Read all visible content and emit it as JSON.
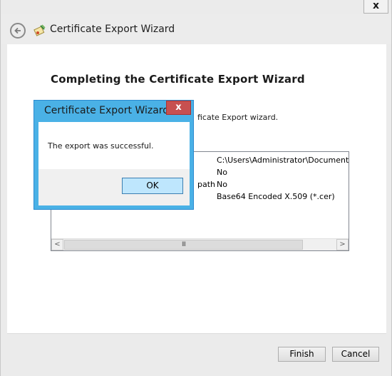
{
  "window": {
    "close_label": "x",
    "title": "Certificate Export Wizard"
  },
  "page": {
    "heading": "Completing the Certificate Export Wizard",
    "intro": "ficate Export wizard."
  },
  "settings": {
    "rows": [
      {
        "label": "",
        "value": "C:\\Users\\Administrator\\Documents\\CA"
      },
      {
        "label": "",
        "value": "No"
      },
      {
        "label": "path",
        "value": "No"
      },
      {
        "label": "",
        "value": "Base64 Encoded X.509 (*.cer)"
      }
    ],
    "scroll_left": "<",
    "scroll_right": ">",
    "scroll_grip": "III"
  },
  "footer": {
    "finish_label": "Finish",
    "cancel_label": "Cancel"
  },
  "dialog": {
    "title": "Certificate Export Wizard",
    "close_label": "x",
    "message": "The export was successful.",
    "ok_label": "OK"
  },
  "colors": {
    "dialog_frame": "#4ab1e6",
    "dialog_close": "#c75050",
    "ok_button": "#bee6fd"
  }
}
